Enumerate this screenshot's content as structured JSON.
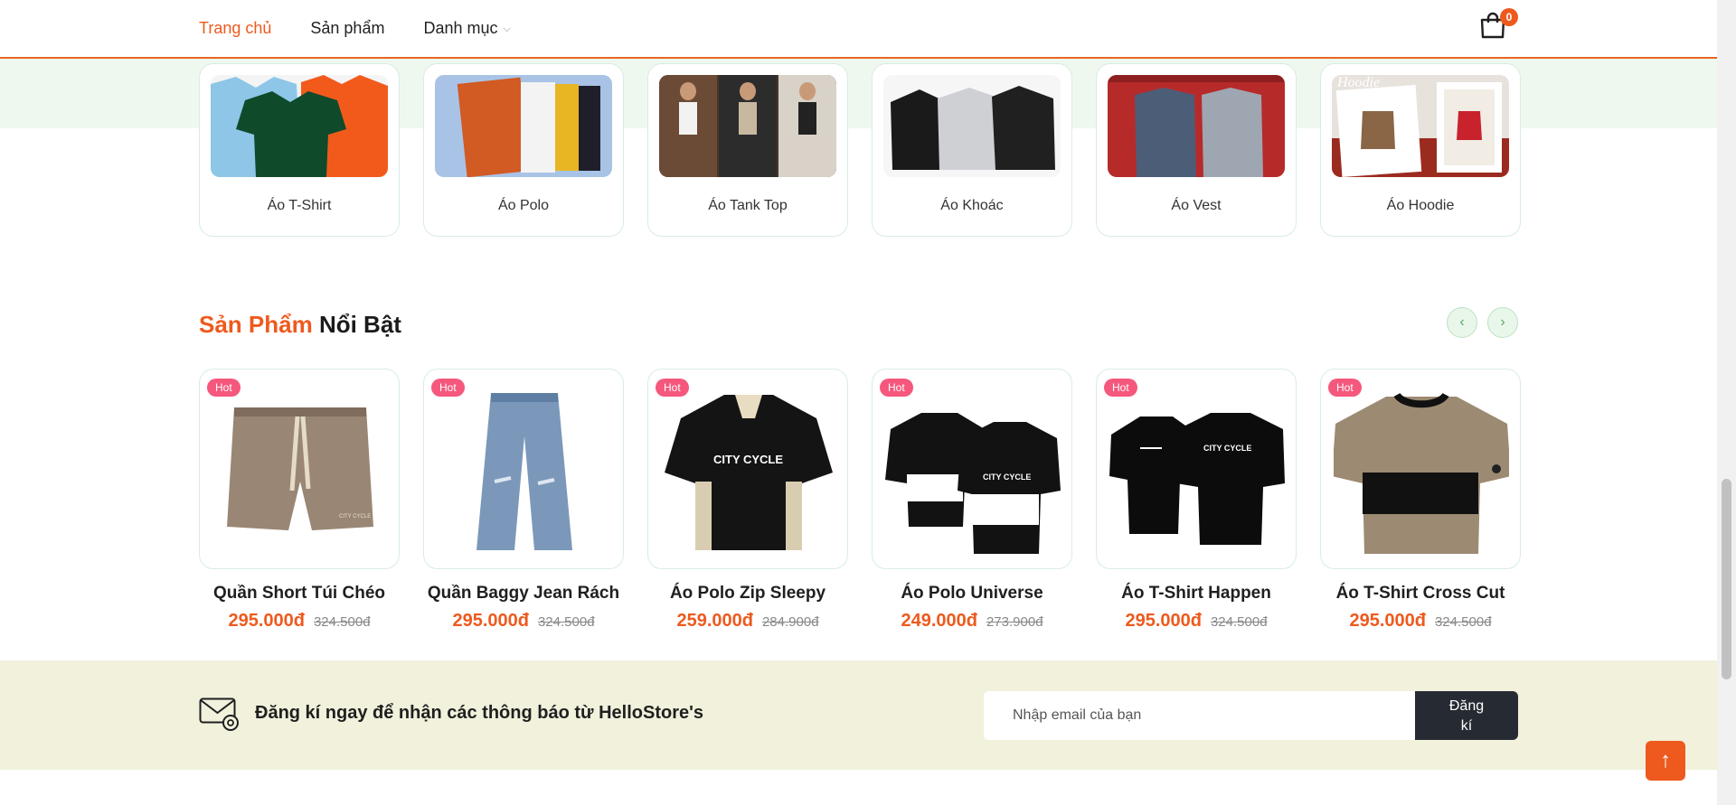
{
  "nav": {
    "items": [
      {
        "label": "Trang chủ",
        "active": true
      },
      {
        "label": "Sản phẩm",
        "active": false
      },
      {
        "label": "Danh mục",
        "active": false
      }
    ],
    "cart_count": "0",
    "cart_icon": "shopping-bag-icon"
  },
  "categories": [
    {
      "label": "Áo T-Shirt"
    },
    {
      "label": "Áo Polo"
    },
    {
      "label": "Áo Tank Top"
    },
    {
      "label": "Áo Khoác"
    },
    {
      "label": "Áo Vest"
    },
    {
      "label": "Áo Hoodie",
      "image_text": "Hoodie"
    }
  ],
  "featured": {
    "title_accent": "Sản Phẩm",
    "title_rest": "Nổi Bật",
    "prev_icon": "chevron-left-icon",
    "next_icon": "chevron-right-icon"
  },
  "products": [
    {
      "badge": "Hot",
      "name": "Quần Short Túi Chéo",
      "price": "295.000đ",
      "old_price": "324.500đ"
    },
    {
      "badge": "Hot",
      "name": "Quần Baggy Jean Rách",
      "price": "295.000đ",
      "old_price": "324.500đ"
    },
    {
      "badge": "Hot",
      "name": "Áo Polo Zip Sleepy",
      "price": "259.000đ",
      "old_price": "284.900đ",
      "print": "CITY CYCLE"
    },
    {
      "badge": "Hot",
      "name": "Áo Polo Universe",
      "price": "249.000đ",
      "old_price": "273.900đ",
      "print": "CITY CYCLE"
    },
    {
      "badge": "Hot",
      "name": "Áo T-Shirt Happen",
      "price": "295.000đ",
      "old_price": "324.500đ",
      "print": "CITY CYCLE"
    },
    {
      "badge": "Hot",
      "name": "Áo T-Shirt Cross Cut",
      "price": "295.000đ",
      "old_price": "324.500đ"
    }
  ],
  "newsletter": {
    "text": "Đăng kí ngay để nhận các thông báo từ HelloStore's",
    "placeholder": "Nhập email của bạn",
    "button_line1": "Đăng",
    "button_line2": "kí",
    "icon": "mail-at-icon"
  },
  "back_to_top": {
    "icon": "arrow-up-icon",
    "glyph": "↑"
  },
  "colors": {
    "accent": "#ee5a1e",
    "hot_badge": "#f5577d",
    "newsletter_bg": "#f1f1dc",
    "category_band": "#eff8ef"
  }
}
